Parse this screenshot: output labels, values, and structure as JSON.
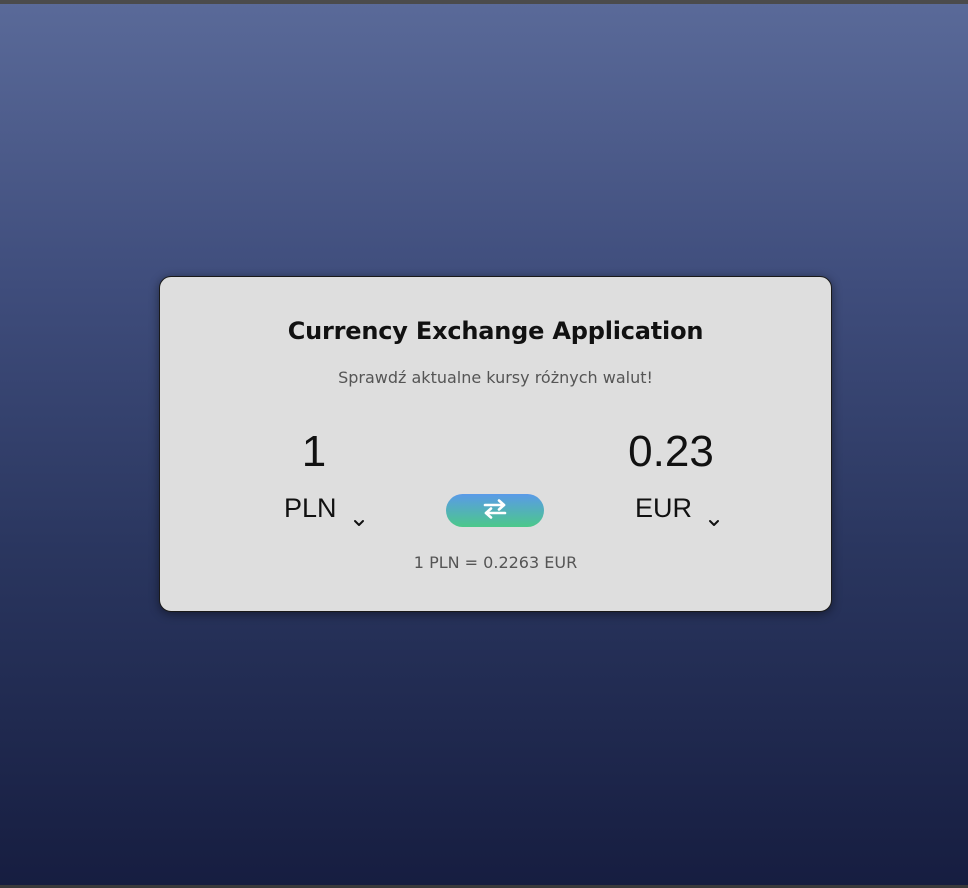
{
  "app": {
    "title": "Currency Exchange Application",
    "subtitle": "Sprawdź aktualne kursy różnych walut!"
  },
  "converter": {
    "from": {
      "amount": "1",
      "currency": "PLN"
    },
    "to": {
      "amount": "0.23",
      "currency": "EUR"
    },
    "swap_icon": "swap-arrows-icon",
    "rate_text": "1 PLN = 0.2263 EUR"
  },
  "colors": {
    "card_background": "#dedede",
    "swap_gradient_top": "#5a9ae8",
    "swap_gradient_bottom": "#4cc88a",
    "page_gradient_top": "#5a6a99",
    "page_gradient_bottom": "#161d40"
  }
}
